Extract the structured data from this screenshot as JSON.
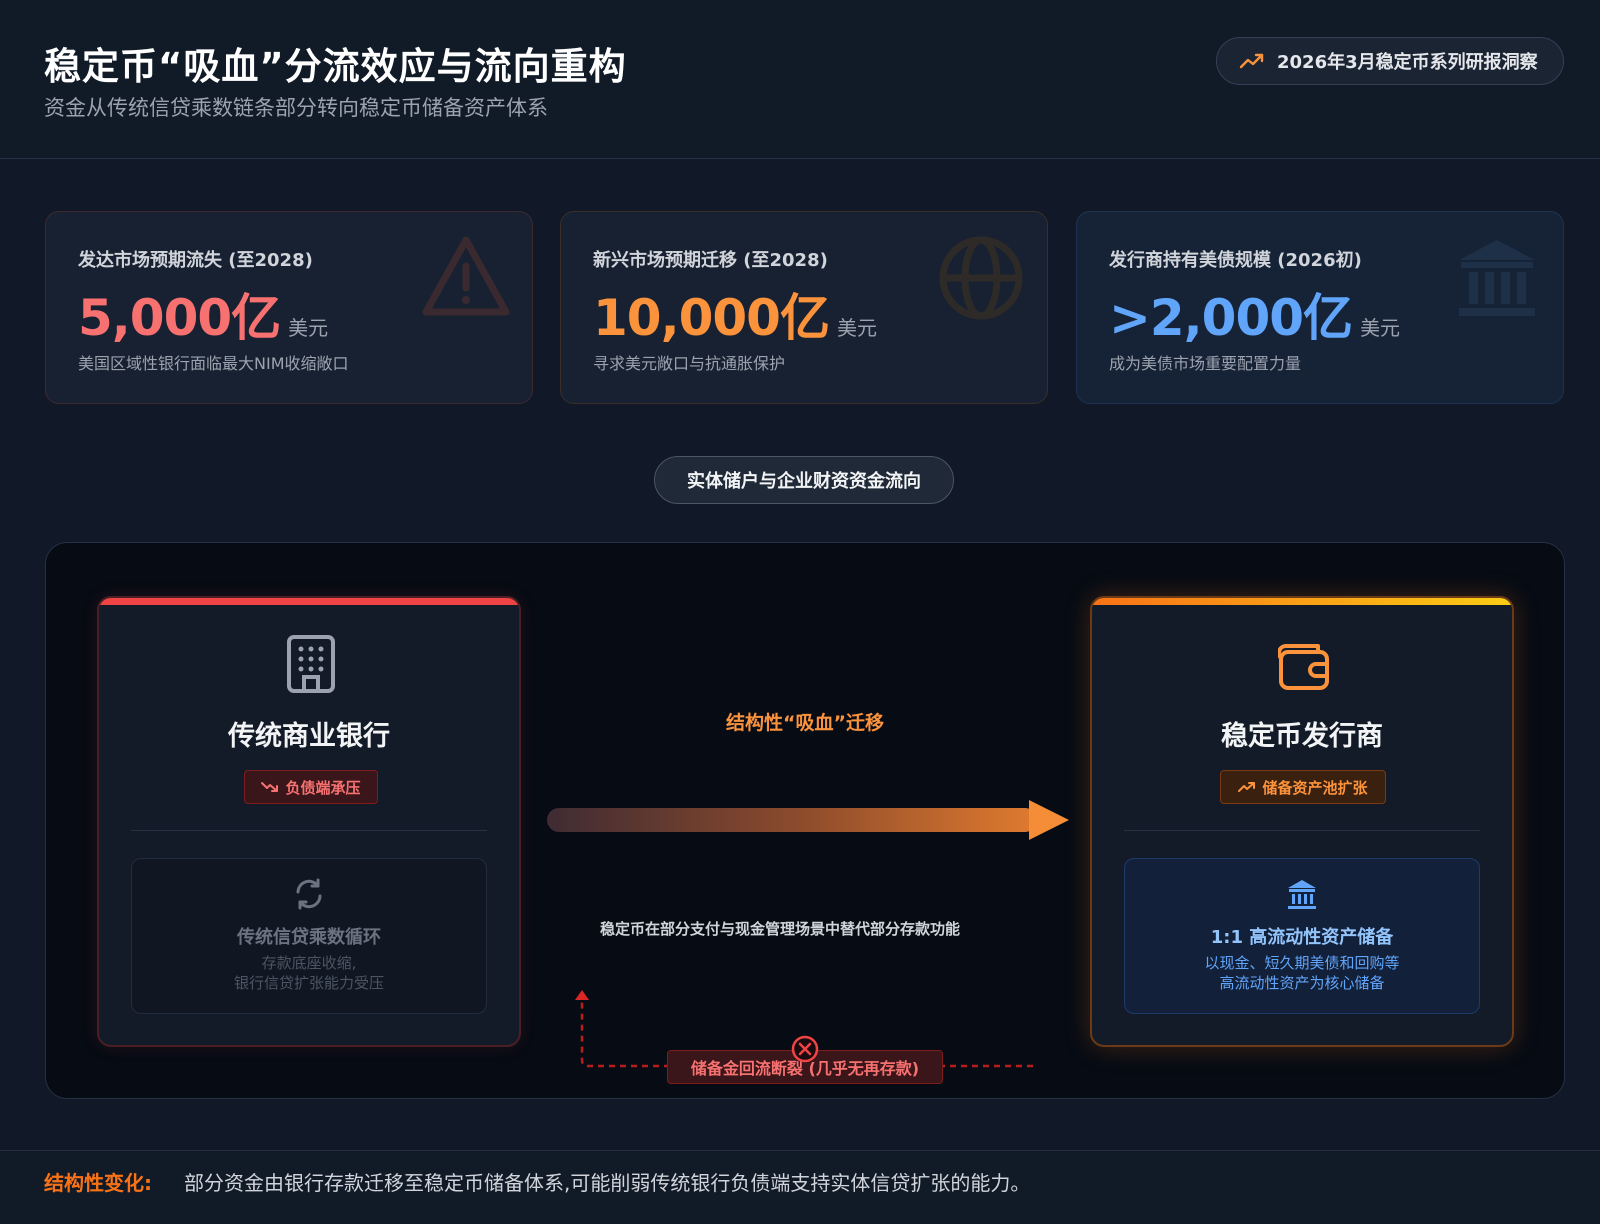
{
  "header": {
    "title": "稳定币“吸血”分流效应与流向重构",
    "subtitle": "资金从传统信贷乘数链条部分转向稳定币储备资产体系",
    "badge": "2026年3月稳定币系列研报洞察",
    "badge_icon": "trending-up-icon"
  },
  "stats": [
    {
      "label": "发达市场预期流失 (至2028)",
      "value": "5,000亿",
      "unit": "美元",
      "desc": "美国区域性银行面临最大NIM收缩敞口",
      "color": "#f87171",
      "icon": "warning-icon"
    },
    {
      "label": "新兴市场预期迁移 (至2028)",
      "value": "10,000亿",
      "unit": "美元",
      "desc": "寻求美元敞口与抗通胀保护",
      "color": "#fb923c",
      "icon": "globe-icon"
    },
    {
      "label": "发行商持有美债规模 (2026初)",
      "value": ">2,000亿",
      "unit": "美元",
      "desc": "成为美债市场重要配置力量",
      "color": "#60a5fa",
      "icon": "bank-icon"
    }
  ],
  "section_label": "实体储户与企业财资资金流向",
  "bank": {
    "name": "传统商业银行",
    "tag": "负债端承压",
    "inner_title": "传统信贷乘数循环",
    "inner_desc_1": "存款底座收缩,",
    "inner_desc_2": "银行信贷扩张能力受压"
  },
  "issuer": {
    "name": "稳定币发行商",
    "tag": "储备资产池扩张",
    "inner_title": "1:1 高流动性资产储备",
    "inner_desc_1": "以现金、短久期美债和回购等",
    "inner_desc_2": "高流动性资产为核心储备"
  },
  "flow": {
    "migration_label": "结构性“吸血”迁移",
    "replace_note": "稳定币在部分支付与现金管理场景中替代部分存款功能",
    "break_label": "储备金回流断裂 (几乎无再存款)"
  },
  "footer": {
    "label": "结构性变化:",
    "text": "部分资金由银行存款迁移至稳定币储备体系,可能削弱传统银行负债端支持实体信贷扩张的能力。"
  }
}
